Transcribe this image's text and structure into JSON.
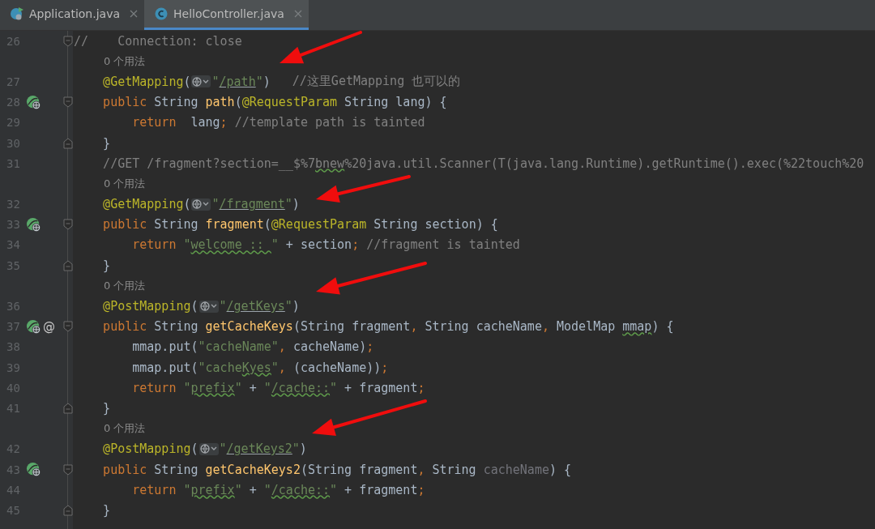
{
  "tabs": [
    {
      "label": "Application.java",
      "kind": "app",
      "selected": false
    },
    {
      "label": "HelloController.java",
      "kind": "class",
      "selected": true
    }
  ],
  "lines": [
    {
      "number": "26",
      "kind": "outer",
      "gutter": [
        {
          "kind": "fold-start"
        }
      ],
      "tokens": [
        {
          "kind": "cmt",
          "text": "//    Connection: close"
        }
      ]
    },
    {
      "kind": "hint",
      "text": "0 个用法"
    },
    {
      "number": "27",
      "tokens": [
        {
          "kind": "ann",
          "text": "@GetMapping"
        },
        {
          "kind": "plain",
          "text": "("
        },
        {
          "kind": "inlay"
        },
        {
          "kind": "str",
          "text": "\""
        },
        {
          "kind": "link",
          "text": "/path"
        },
        {
          "kind": "str",
          "text": "\""
        },
        {
          "kind": "plain",
          "text": ")"
        },
        {
          "kind": "cmt",
          "text": "//这里GetMapping 也可以的"
        }
      ]
    },
    {
      "number": "28",
      "gutter": [
        {
          "kind": "endpoint"
        },
        {
          "kind": "fold-start"
        }
      ],
      "tokens": [
        {
          "kind": "kw",
          "text": "public"
        },
        {
          "kind": "plain",
          "text": "String"
        },
        {
          "kind": "fn",
          "text": "path"
        },
        {
          "kind": "plain",
          "text": "("
        },
        {
          "kind": "ann",
          "text": "@RequestParam"
        },
        {
          "kind": "plain",
          "text": " String lang) {"
        }
      ],
      "children": [
        {
          "number": "29",
          "tokens": [
            {
              "kind": "kw",
              "text": "return"
            },
            {
              "kind": "plain",
              "text": " lang"
            },
            {
              "kind": "punct",
              "text": ";"
            },
            {
              "kind": "cmt",
              "text": " //template path is tainted"
            }
          ]
        }
      ]
    },
    {
      "number": "30",
      "gutter": [
        {
          "kind": "fold-end"
        }
      ],
      "tokens": [
        {
          "kind": "plain",
          "text": "}"
        }
      ]
    },
    {
      "number": "31",
      "tokens": [
        {
          "kind": "cmt",
          "text": "//GET /fragment?section=__$%7"
        },
        {
          "kind": "cmttypo",
          "text": "bnew"
        },
        {
          "kind": "cmt",
          "text": "%20java.util.Scanner(T(java.lang.Runtime).getRuntime().exec(%22touch%20"
        }
      ]
    },
    {
      "kind": "hint",
      "text": "0 个用法"
    },
    {
      "number": "32",
      "tokens": [
        {
          "kind": "ann",
          "text": "@GetMapping"
        },
        {
          "kind": "plain",
          "text": "("
        },
        {
          "kind": "inlay"
        },
        {
          "kind": "str",
          "text": "\""
        },
        {
          "kind": "link",
          "text": "/fragment"
        },
        {
          "kind": "str",
          "text": "\""
        },
        {
          "kind": "plain",
          "text": ")"
        }
      ]
    },
    {
      "number": "33",
      "gutter": [
        {
          "kind": "endpoint"
        },
        {
          "kind": "fold-start"
        }
      ],
      "tokens": [
        {
          "kind": "kw",
          "text": "public"
        },
        {
          "kind": "plain",
          "text": "String"
        },
        {
          "kind": "fn",
          "text": "fragment"
        },
        {
          "kind": "plain",
          "text": "("
        },
        {
          "kind": "ann",
          "text": "@RequestParam"
        },
        {
          "kind": "plain",
          "text": " String section) {"
        }
      ],
      "children": [
        {
          "number": "34",
          "tokens": [
            {
              "kind": "kw",
              "text": "return"
            },
            {
              "kind": "str",
              "text": "\""
            },
            {
              "kind": "strtypo",
              "text": "welcome :: "
            },
            {
              "kind": "str",
              "text": "\""
            },
            {
              "kind": "plain",
              "text": " + section"
            },
            {
              "kind": "punct",
              "text": ";"
            },
            {
              "kind": "cmt",
              "text": " //fragment is tainted"
            }
          ]
        }
      ]
    },
    {
      "number": "35",
      "gutter": [
        {
          "kind": "fold-end"
        }
      ],
      "tokens": [
        {
          "kind": "plain",
          "text": "}"
        }
      ]
    },
    {
      "kind": "hint",
      "text": "0 个用法"
    },
    {
      "number": "36",
      "tokens": [
        {
          "kind": "ann",
          "text": "@PostMapping"
        },
        {
          "kind": "plain",
          "text": "("
        },
        {
          "kind": "inlay"
        },
        {
          "kind": "str",
          "text": "\""
        },
        {
          "kind": "link",
          "text": "/getKeys"
        },
        {
          "kind": "str",
          "text": "\""
        },
        {
          "kind": "plain",
          "text": ")"
        }
      ]
    },
    {
      "number": "37",
      "gutter": [
        {
          "kind": "endpoint"
        },
        {
          "kind": "symbol",
          "text": "@"
        },
        {
          "kind": "fold-start"
        }
      ],
      "tokens": [
        {
          "kind": "kw",
          "text": "public"
        },
        {
          "kind": "plain",
          "text": "String"
        },
        {
          "kind": "fn",
          "text": "getCacheKeys"
        },
        {
          "kind": "plain",
          "text": "(String fragment"
        },
        {
          "kind": "punct",
          "text": ","
        },
        {
          "kind": "plain",
          "text": "String cacheName"
        },
        {
          "kind": "punct",
          "text": ","
        },
        {
          "kind": "plain",
          "text": "ModelMap"
        },
        {
          "kind": "plaintypo",
          "text": "mmap"
        },
        {
          "kind": "plain",
          "text": ") {"
        }
      ],
      "children": [
        {
          "number": "38",
          "tokens": [
            {
              "kind": "plain",
              "text": "mmap.put("
            },
            {
              "kind": "str",
              "text": "\"cacheName\""
            },
            {
              "kind": "punct",
              "text": ","
            },
            {
              "kind": "plain",
              "text": "cacheName)"
            },
            {
              "kind": "punct",
              "text": ";"
            }
          ]
        },
        {
          "number": "39",
          "tokens": [
            {
              "kind": "plain",
              "text": "mmap.put("
            },
            {
              "kind": "str",
              "text": "\"cache"
            },
            {
              "kind": "strtypo",
              "text": "Kyes"
            },
            {
              "kind": "str",
              "text": "\""
            },
            {
              "kind": "punct",
              "text": ","
            },
            {
              "kind": "plain",
              "text": "(cacheName))"
            },
            {
              "kind": "punct",
              "text": ";"
            }
          ]
        },
        {
          "number": "40",
          "tokens": [
            {
              "kind": "kw",
              "text": "return"
            },
            {
              "kind": "str",
              "text": "\""
            },
            {
              "kind": "strtypo",
              "text": "prefix"
            },
            {
              "kind": "str",
              "text": "\""
            },
            {
              "kind": "plain",
              "text": " + "
            },
            {
              "kind": "str",
              "text": "\""
            },
            {
              "kind": "strtypo",
              "text": "/cache::"
            },
            {
              "kind": "str",
              "text": "\""
            },
            {
              "kind": "plain",
              "text": " + fragment"
            },
            {
              "kind": "punct",
              "text": ";"
            }
          ]
        }
      ]
    },
    {
      "number": "41",
      "gutter": [
        {
          "kind": "fold-end"
        }
      ],
      "tokens": [
        {
          "kind": "plain",
          "text": "}"
        }
      ]
    },
    {
      "kind": "hint",
      "text": "0 个用法"
    },
    {
      "number": "42",
      "tokens": [
        {
          "kind": "ann",
          "text": "@PostMapping"
        },
        {
          "kind": "plain",
          "text": "("
        },
        {
          "kind": "inlay"
        },
        {
          "kind": "str",
          "text": "\""
        },
        {
          "kind": "link",
          "text": "/getKeys2"
        },
        {
          "kind": "str",
          "text": "\""
        },
        {
          "kind": "plain",
          "text": ")"
        }
      ]
    },
    {
      "number": "43",
      "gutter": [
        {
          "kind": "endpoint"
        },
        {
          "kind": "fold-start"
        }
      ],
      "tokens": [
        {
          "kind": "kw",
          "text": "public"
        },
        {
          "kind": "plain",
          "text": "String"
        },
        {
          "kind": "fn",
          "text": "getCacheKeys2"
        },
        {
          "kind": "plain",
          "text": "(String fragment"
        },
        {
          "kind": "punct",
          "text": ","
        },
        {
          "kind": "plain",
          "text": "String"
        },
        {
          "kind": "unused",
          "text": "cacheName"
        },
        {
          "kind": "plain",
          "text": ") {"
        }
      ],
      "children": [
        {
          "number": "44",
          "tokens": [
            {
              "kind": "kw",
              "text": "return"
            },
            {
              "kind": "str",
              "text": "\""
            },
            {
              "kind": "strtypo",
              "text": "prefix"
            },
            {
              "kind": "str",
              "text": "\""
            },
            {
              "kind": "plain",
              "text": " + "
            },
            {
              "kind": "str",
              "text": "\""
            },
            {
              "kind": "strtypo",
              "text": "/cache::"
            },
            {
              "kind": "str",
              "text": "\""
            },
            {
              "kind": "plain",
              "text": " + fragment"
            },
            {
              "kind": "punct",
              "text": ";"
            }
          ]
        }
      ]
    },
    {
      "number": "45",
      "gutter": [
        {
          "kind": "fold-end"
        }
      ],
      "tokens": [
        {
          "kind": "plain",
          "text": "}"
        }
      ]
    }
  ]
}
